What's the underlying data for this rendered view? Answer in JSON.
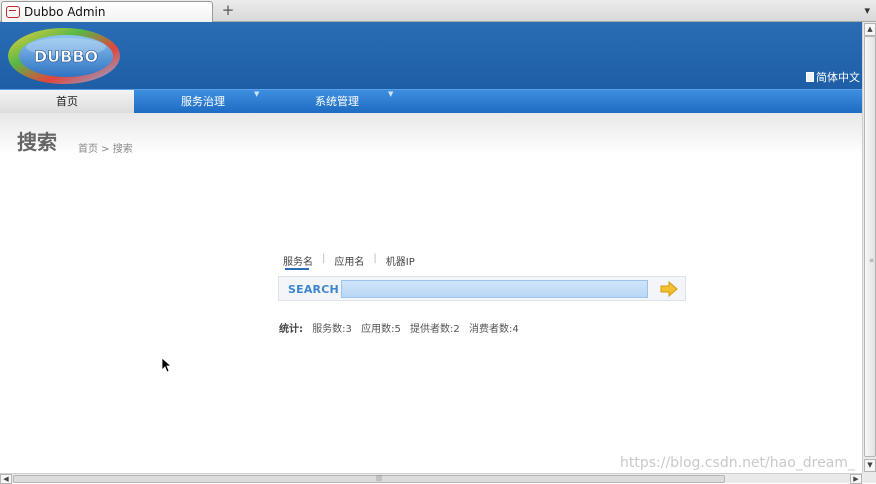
{
  "browser": {
    "tab_title": "Dubbo Admin",
    "new_tab_glyph": "+",
    "tab_menu_glyph": "▾"
  },
  "header": {
    "logo_text": "DUBBO",
    "language_link": "简体中文"
  },
  "nav": {
    "home": "首页",
    "services": "服务治理",
    "system": "系统管理",
    "caret_glyph": "▼"
  },
  "page": {
    "title": "搜索",
    "breadcrumb": "首页 > 搜索"
  },
  "search": {
    "tabs": [
      {
        "label": "服务名",
        "active": true
      },
      {
        "label": "应用名",
        "active": false
      },
      {
        "label": "机器IP",
        "active": false
      }
    ],
    "separator": "|",
    "label": "SEARCH",
    "input_value": ""
  },
  "stats": {
    "label": "统计:",
    "services": "服务数:3",
    "apps": "应用数:5",
    "providers": "提供者数:2",
    "consumers": "消费者数:4"
  },
  "watermark": "https://blog.csdn.net/hao_dream_",
  "colors": {
    "header_bg": "#1d5ea7",
    "nav_bg": "#2b7ed4",
    "search_accent": "#3d86cf"
  }
}
